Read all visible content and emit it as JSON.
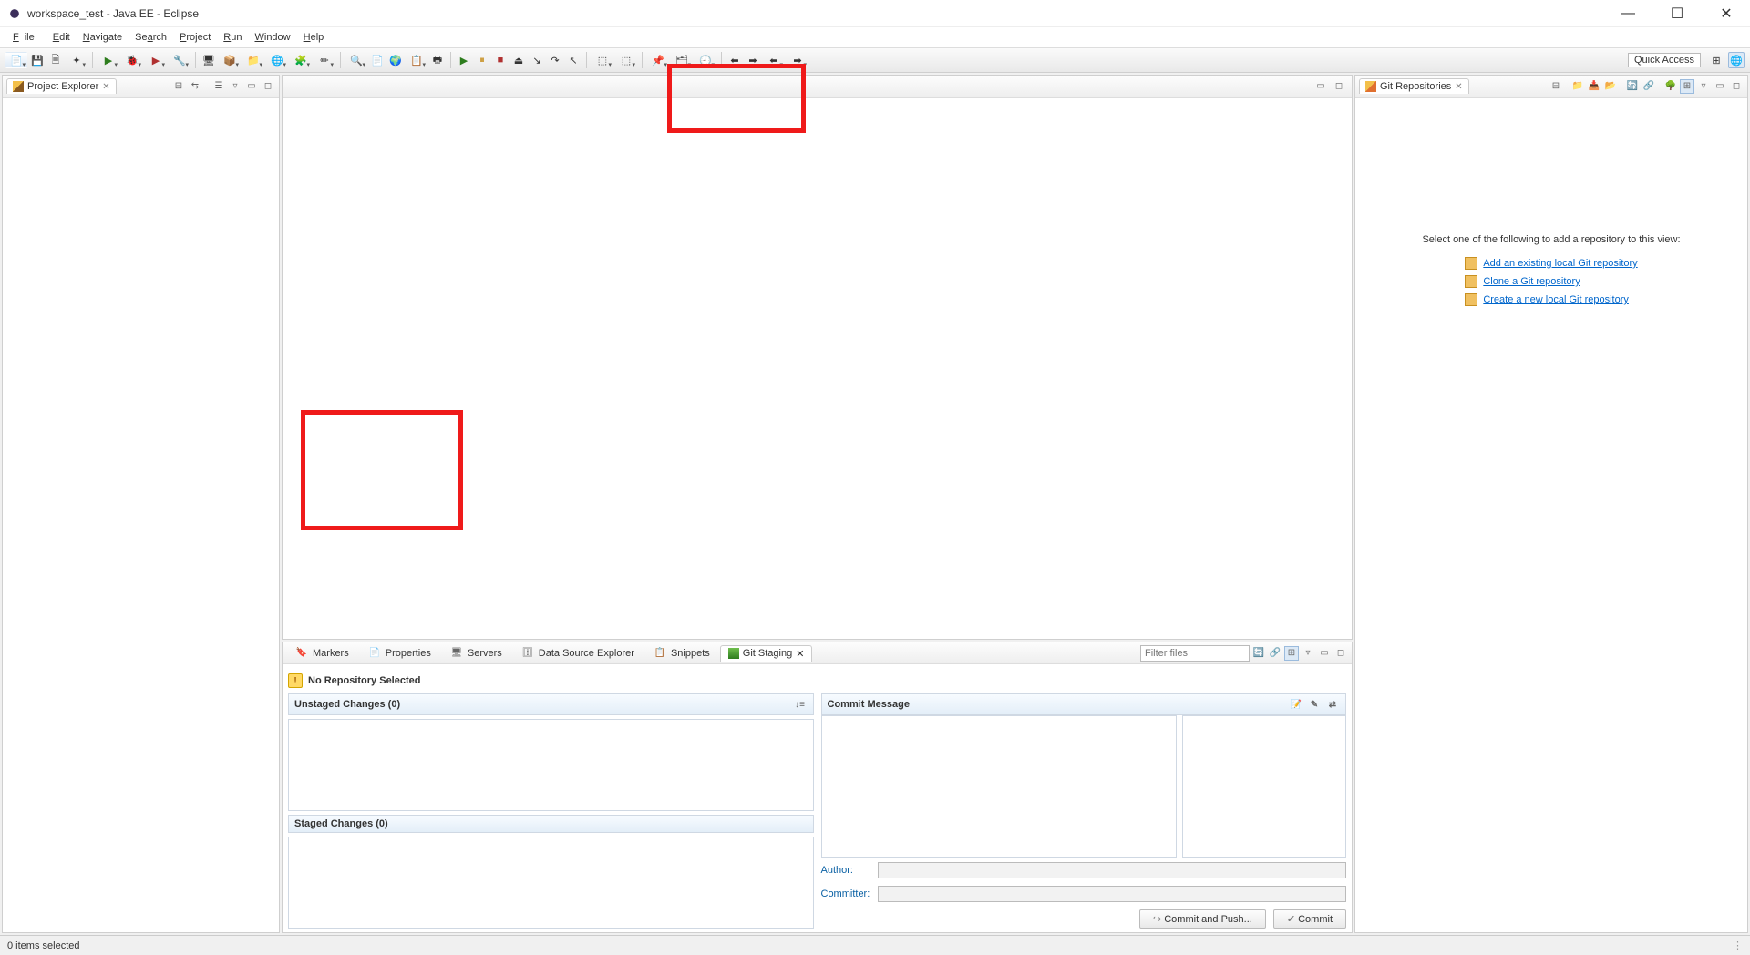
{
  "titlebar": {
    "title": "workspace_test - Java EE - Eclipse"
  },
  "menubar": [
    "File",
    "Edit",
    "Navigate",
    "Search",
    "Project",
    "Run",
    "Window",
    "Help"
  ],
  "quick_access": "Quick Access",
  "left": {
    "tab": "Project Explorer"
  },
  "bottom": {
    "tabs": [
      "Markers",
      "Properties",
      "Servers",
      "Data Source Explorer",
      "Snippets",
      "Git Staging"
    ],
    "active_tab": "Git Staging",
    "filter_placeholder": "Filter files",
    "no_repo": "No Repository Selected",
    "unstaged": "Unstaged Changes (0)",
    "staged": "Staged Changes (0)",
    "commit_msg": "Commit Message",
    "author": "Author:",
    "committer": "Committer:",
    "btn_commit_push": "Commit and Push...",
    "btn_commit": "Commit"
  },
  "right": {
    "tab": "Git Repositories",
    "prompt": "Select one of the following to add a repository to this view:",
    "links": [
      "Add an existing local Git repository",
      "Clone a Git repository",
      "Create a new local Git repository"
    ]
  },
  "statusbar": "0 items selected"
}
